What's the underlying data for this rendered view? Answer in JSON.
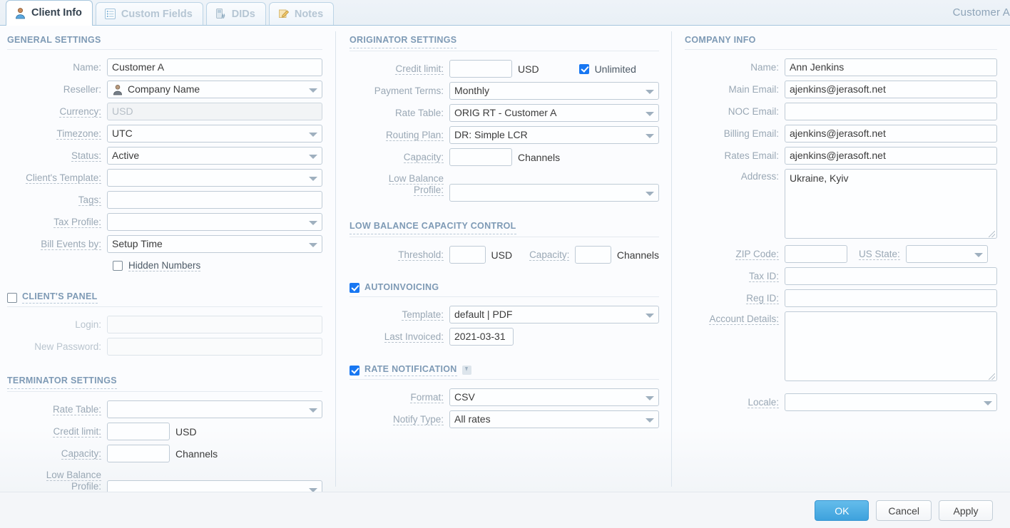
{
  "window": {
    "record_title": "Customer A"
  },
  "tabs": [
    {
      "label": "Client Info",
      "icon": "user-icon",
      "active": true
    },
    {
      "label": "Custom Fields",
      "icon": "list-icon",
      "active": false
    },
    {
      "label": "DIDs",
      "icon": "phone-hash-icon",
      "active": false
    },
    {
      "label": "Notes",
      "icon": "note-pencil-icon",
      "active": false
    }
  ],
  "general_settings": {
    "title": "GENERAL SETTINGS",
    "name": {
      "label": "Name:",
      "value": "Customer A"
    },
    "reseller": {
      "label": "Reseller:",
      "value": "Company Name"
    },
    "currency": {
      "label": "Currency:",
      "value": "USD"
    },
    "timezone": {
      "label": "Timezone:",
      "value": "UTC"
    },
    "status": {
      "label": "Status:",
      "value": "Active"
    },
    "clients_template": {
      "label": "Client's Template:",
      "value": ""
    },
    "tags": {
      "label": "Tags:",
      "value": ""
    },
    "tax_profile": {
      "label": "Tax Profile:",
      "value": ""
    },
    "bill_events_by": {
      "label": "Bill Events by:",
      "value": "Setup Time"
    },
    "hidden_numbers": {
      "label": "Hidden Numbers",
      "checked": false
    }
  },
  "clients_panel": {
    "title": "CLIENT'S PANEL",
    "checked": false,
    "login": {
      "label": "Login:",
      "value": ""
    },
    "new_password": {
      "label": "New Password:",
      "value": ""
    }
  },
  "terminator_settings": {
    "title": "TERMINATOR SETTINGS",
    "rate_table": {
      "label": "Rate Table:",
      "value": ""
    },
    "credit_limit": {
      "label": "Credit limit:",
      "value": "",
      "unit": "USD"
    },
    "capacity": {
      "label": "Capacity:",
      "value": "",
      "unit": "Channels"
    },
    "low_balance_profile": {
      "label_line1": "Low Balance",
      "label_line2": "Profile:",
      "value": ""
    }
  },
  "originator_settings": {
    "title": "ORIGINATOR SETTINGS",
    "credit_limit": {
      "label": "Credit limit:",
      "value": "",
      "unit": "USD"
    },
    "unlimited": {
      "label": "Unlimited",
      "checked": true
    },
    "payment_terms": {
      "label": "Payment Terms:",
      "value": "Monthly"
    },
    "rate_table": {
      "label": "Rate Table:",
      "value": "ORIG RT - Customer A"
    },
    "routing_plan": {
      "label": "Routing Plan:",
      "value": "DR: Simple LCR"
    },
    "capacity": {
      "label": "Capacity:",
      "value": "",
      "unit": "Channels"
    },
    "low_balance_profile": {
      "label_line1": "Low Balance",
      "label_line2": "Profile:",
      "value": ""
    }
  },
  "low_balance_capacity_control": {
    "title": "LOW BALANCE CAPACITY CONTROL",
    "threshold": {
      "label": "Threshold:",
      "value": "",
      "unit": "USD"
    },
    "capacity": {
      "label": "Capacity:",
      "value": "",
      "unit": "Channels"
    }
  },
  "autoinvoicing": {
    "title": "AUTOINVOICING",
    "checked": true,
    "template": {
      "label": "Template:",
      "value": "default | PDF"
    },
    "last_invoiced": {
      "label": "Last Invoiced:",
      "value": "2021-03-31"
    }
  },
  "rate_notification": {
    "title": "RATE NOTIFICATION",
    "checked": true,
    "download_icon": "download-icon",
    "format": {
      "label": "Format:",
      "value": "CSV"
    },
    "notify_type": {
      "label": "Notify Type:",
      "value": "All rates"
    }
  },
  "company_info": {
    "title": "COMPANY INFO",
    "name": {
      "label": "Name:",
      "value": "Ann Jenkins"
    },
    "main_email": {
      "label": "Main Email:",
      "value": "ajenkins@jerasoft.net"
    },
    "noc_email": {
      "label": "NOC Email:",
      "value": ""
    },
    "billing_email": {
      "label": "Billing Email:",
      "value": "ajenkins@jerasoft.net"
    },
    "rates_email": {
      "label": "Rates Email:",
      "value": "ajenkins@jerasoft.net"
    },
    "address": {
      "label": "Address:",
      "value": "Ukraine, Kyiv"
    },
    "zip_code": {
      "label": "ZIP Code:",
      "value": ""
    },
    "us_state": {
      "label": "US State:",
      "value": ""
    },
    "tax_id": {
      "label": "Tax ID:",
      "value": ""
    },
    "reg_id": {
      "label": "Reg ID:",
      "value": ""
    },
    "account_details": {
      "label": "Account Details:",
      "value": ""
    },
    "locale": {
      "label": "Locale:",
      "value": ""
    }
  },
  "footer": {
    "ok": "OK",
    "cancel": "Cancel",
    "apply": "Apply"
  },
  "colors": {
    "accent": "#3ea2dd",
    "checkbox": "#1877f2",
    "section_title": "#7e9ab5",
    "label": "#9aa8b5"
  }
}
